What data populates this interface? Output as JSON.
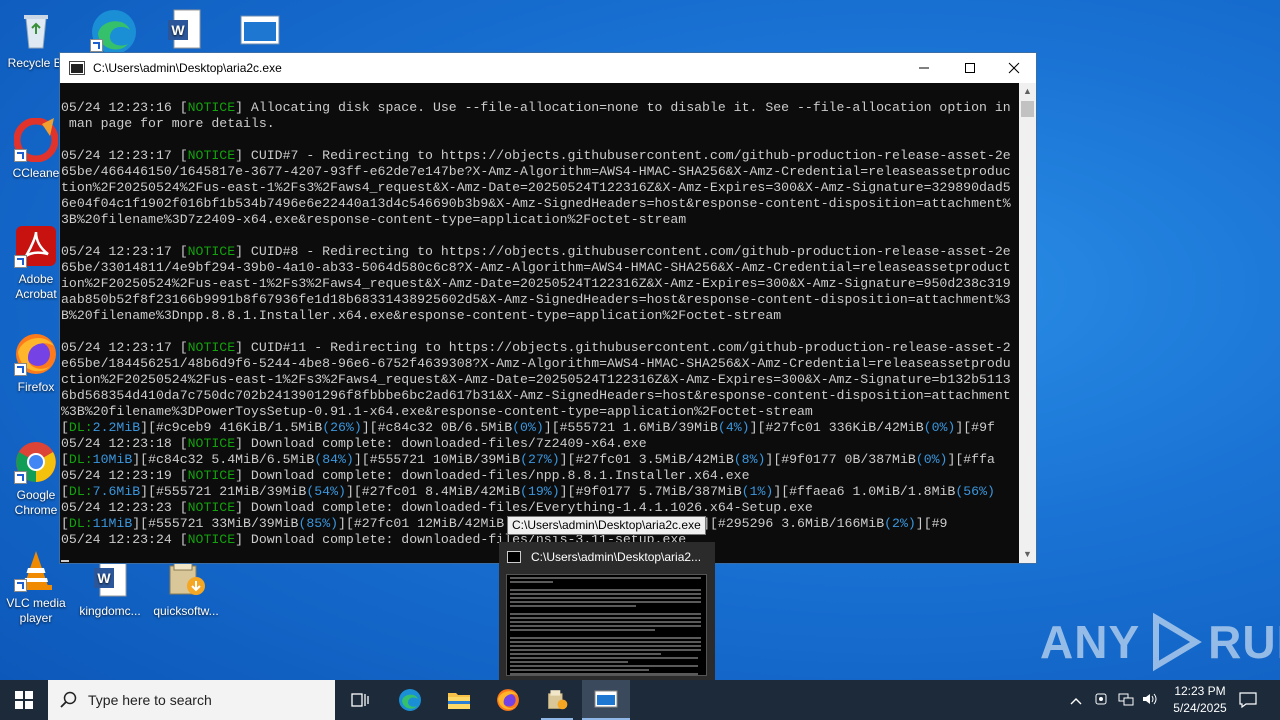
{
  "desktop": {
    "icons": [
      {
        "label": "Recycle Bin",
        "display": "Recycle Bi"
      },
      {
        "label": "CCleaner",
        "display": "CCleane"
      },
      {
        "label": "Adobe Acrobat",
        "display": "Adobe Acrobat"
      },
      {
        "label": "Firefox",
        "display": "Firefox"
      },
      {
        "label": "Google Chrome",
        "display": "Google Chrome"
      },
      {
        "label": "VLC media player",
        "display": "VLC media player"
      },
      {
        "label": "kingdomc...",
        "display": "kingdomc..."
      },
      {
        "label": "quicksoftw...",
        "display": "quicksoftw..."
      }
    ]
  },
  "console_window": {
    "title": "C:\\Users\\admin\\Desktop\\aria2c.exe",
    "lines": [
      [
        {
          "t": "05/24 12:23:16 ["
        },
        {
          "t": "NOTICE",
          "c": "g"
        },
        {
          "t": "] Allocating disk space. Use --file-allocation=none to disable it. See --file-allocation option in"
        }
      ],
      [
        {
          "t": " man page for more details."
        }
      ],
      [
        {
          "t": ""
        }
      ],
      [
        {
          "t": "05/24 12:23:17 ["
        },
        {
          "t": "NOTICE",
          "c": "g"
        },
        {
          "t": "] CUID#7 - Redirecting to https://objects.githubusercontent.com/github-production-release-asset-2e"
        }
      ],
      [
        {
          "t": "65be/466446150/1645817e-3677-4207-93ff-e62de7e147be?X-Amz-Algorithm=AWS4-HMAC-SHA256&X-Amz-Credential=releaseassetproduc"
        }
      ],
      [
        {
          "t": "tion%2F20250524%2Fus-east-1%2Fs3%2Faws4_request&X-Amz-Date=20250524T122316Z&X-Amz-Expires=300&X-Amz-Signature=329890dad5"
        }
      ],
      [
        {
          "t": "6e04f04c1f1902f016bf1b534b7496e6e22440a13d4c546690b3b9&X-Amz-SignedHeaders=host&response-content-disposition=attachment%"
        }
      ],
      [
        {
          "t": "3B%20filename%3D7z2409-x64.exe&response-content-type=application%2Foctet-stream"
        }
      ],
      [
        {
          "t": ""
        }
      ],
      [
        {
          "t": "05/24 12:23:17 ["
        },
        {
          "t": "NOTICE",
          "c": "g"
        },
        {
          "t": "] CUID#8 - Redirecting to https://objects.githubusercontent.com/github-production-release-asset-2e"
        }
      ],
      [
        {
          "t": "65be/33014811/4e9bf294-39b0-4a10-ab33-5064d580c6c8?X-Amz-Algorithm=AWS4-HMAC-SHA256&X-Amz-Credential=releaseassetproduct"
        }
      ],
      [
        {
          "t": "ion%2F20250524%2Fus-east-1%2Fs3%2Faws4_request&X-Amz-Date=20250524T122316Z&X-Amz-Expires=300&X-Amz-Signature=950d238c319"
        }
      ],
      [
        {
          "t": "aab850b52f8f23166b9991b8f67936fe1d18b68331438925602d5&X-Amz-SignedHeaders=host&response-content-disposition=attachment%3"
        }
      ],
      [
        {
          "t": "B%20filename%3Dnpp.8.8.1.Installer.x64.exe&response-content-type=application%2Foctet-stream"
        }
      ],
      [
        {
          "t": ""
        }
      ],
      [
        {
          "t": "05/24 12:23:17 ["
        },
        {
          "t": "NOTICE",
          "c": "g"
        },
        {
          "t": "] CUID#11 - Redirecting to https://objects.githubusercontent.com/github-production-release-asset-2"
        }
      ],
      [
        {
          "t": "e65be/184456251/48b6d9f6-5244-4be8-96e6-6752f4639308?X-Amz-Algorithm=AWS4-HMAC-SHA256&X-Amz-Credential=releaseassetprodu"
        }
      ],
      [
        {
          "t": "ction%2F20250524%2Fus-east-1%2Fs3%2Faws4_request&X-Amz-Date=20250524T122316Z&X-Amz-Expires=300&X-Amz-Signature=b132b5113"
        }
      ],
      [
        {
          "t": "6bd568354d410da7c750dc702b2413901296f8fbbbe6bc2ad617b31&X-Amz-SignedHeaders=host&response-content-disposition=attachment"
        }
      ],
      [
        {
          "t": "%3B%20filename%3DPowerToysSetup-0.91.1-x64.exe&response-content-type=application%2Foctet-stream"
        }
      ],
      [
        {
          "t": "["
        },
        {
          "t": "DL:",
          "c": "g"
        },
        {
          "t": "2.2MiB",
          "c": "c"
        },
        {
          "t": "]["
        },
        {
          "t": "#c9ceb9 416KiB/1.5MiB"
        },
        {
          "t": "(26%)",
          "c": "c"
        },
        {
          "t": "]["
        },
        {
          "t": "#c84c32 0B/6.5MiB"
        },
        {
          "t": "(0%)",
          "c": "c"
        },
        {
          "t": "]["
        },
        {
          "t": "#555721 1.6MiB/39MiB"
        },
        {
          "t": "(4%)",
          "c": "c"
        },
        {
          "t": "]["
        },
        {
          "t": "#27fc01 336KiB/42MiB"
        },
        {
          "t": "(0%)",
          "c": "c"
        },
        {
          "t": "][#9f"
        }
      ],
      [
        {
          "t": "05/24 12:23:18 ["
        },
        {
          "t": "NOTICE",
          "c": "g"
        },
        {
          "t": "] Download complete: downloaded-files/7z2409-x64.exe"
        }
      ],
      [
        {
          "t": "["
        },
        {
          "t": "DL:",
          "c": "g"
        },
        {
          "t": "10MiB",
          "c": "c"
        },
        {
          "t": "][#c84c32 5.4MiB/6.5MiB"
        },
        {
          "t": "(84%)",
          "c": "c"
        },
        {
          "t": "][#555721 10MiB/39MiB"
        },
        {
          "t": "(27%)",
          "c": "c"
        },
        {
          "t": "][#27fc01 3.5MiB/42MiB"
        },
        {
          "t": "(8%)",
          "c": "c"
        },
        {
          "t": "][#9f0177 0B/387MiB"
        },
        {
          "t": "(0%)",
          "c": "c"
        },
        {
          "t": "][#ffa"
        }
      ],
      [
        {
          "t": "05/24 12:23:19 ["
        },
        {
          "t": "NOTICE",
          "c": "g"
        },
        {
          "t": "] Download complete: downloaded-files/npp.8.8.1.Installer.x64.exe"
        }
      ],
      [
        {
          "t": "["
        },
        {
          "t": "DL:",
          "c": "g"
        },
        {
          "t": "7.6MiB",
          "c": "c"
        },
        {
          "t": "][#555721 21MiB/39MiB"
        },
        {
          "t": "(54%)",
          "c": "c"
        },
        {
          "t": "][#27fc01 8.4MiB/42MiB"
        },
        {
          "t": "(19%)",
          "c": "c"
        },
        {
          "t": "][#9f0177 5.7MiB/387MiB"
        },
        {
          "t": "(1%)",
          "c": "c"
        },
        {
          "t": "][#ffaea6 1.0MiB/1.8MiB"
        },
        {
          "t": "(56%)",
          "c": "c"
        }
      ],
      [
        {
          "t": "05/24 12:23:23 ["
        },
        {
          "t": "NOTICE",
          "c": "g"
        },
        {
          "t": "] Download complete: downloaded-files/Everything-1.4.1.1026.x64-Setup.exe"
        }
      ],
      [
        {
          "t": "["
        },
        {
          "t": "DL:",
          "c": "g"
        },
        {
          "t": "11MiB",
          "c": "c"
        },
        {
          "t": "][#555721 33MiB/39MiB"
        },
        {
          "t": "(85%)",
          "c": "c"
        },
        {
          "t": "][#27fc01 12MiB/42MiB"
        },
        {
          "t": "                   iB"
        },
        {
          "t": "(3%)",
          "c": "c"
        },
        {
          "t": "][#295296 3.6MiB/166MiB"
        },
        {
          "t": "(2%)",
          "c": "c"
        },
        {
          "t": "][#9"
        }
      ],
      [
        {
          "t": "05/24 12:23:24 ["
        },
        {
          "t": "NOTICE",
          "c": "g"
        },
        {
          "t": "] Download complete: downloaded-files/nsis-3.11-setup.exe"
        }
      ]
    ]
  },
  "tooltip": {
    "text": "C:\\Users\\admin\\Desktop\\aria2c.exe"
  },
  "preview": {
    "title": "C:\\Users\\admin\\Desktop\\aria2..."
  },
  "taskbar": {
    "search_placeholder": "Type here to search",
    "time": "12:23 PM",
    "date": "5/24/2025"
  },
  "watermark": {
    "left": "ANY",
    "right": "RUN"
  },
  "colors": {
    "notice": "#13a10e",
    "value": "#3a96dd",
    "taskbar": "#1c2a3a",
    "desktop": "#1a73d4"
  }
}
